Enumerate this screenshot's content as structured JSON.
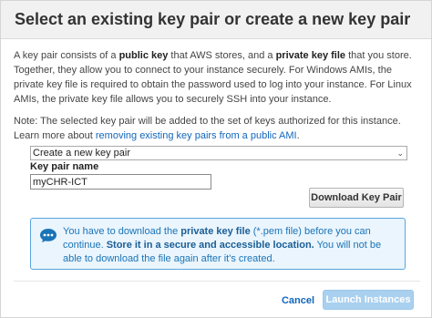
{
  "dialog": {
    "title": "Select an existing key pair or create a new key pair"
  },
  "intro": {
    "t1": "A key pair consists of a ",
    "b1": "public key",
    "t2": " that AWS stores, and a ",
    "b2": "private key file",
    "t3": " that you store. Together, they allow you to connect to your instance securely. For Windows AMIs, the private key file is required to obtain the password used to log into your instance. For Linux AMIs, the private key file allows you to securely SSH into your instance."
  },
  "note": {
    "text": "Note: The selected key pair will be added to the set of keys authorized for this instance. Learn more about ",
    "link": "removing existing key pairs from a public AMI",
    "end": "."
  },
  "key_pair_select": {
    "value": "Create a new key pair",
    "chevron": "⌄"
  },
  "key_pair_name": {
    "label": "Key pair name",
    "value": "myCHR-ICT"
  },
  "download_button": {
    "label": "Download Key Pair"
  },
  "info": {
    "icon": "chat-bubble-icon",
    "t1": "You have to download the ",
    "b1": "private key file",
    "t2": " (*.pem file) before you can continue. ",
    "b2": "Store it in a secure and accessible location.",
    "t3": " You will not be able to download the file again after it's created."
  },
  "footer": {
    "cancel_label": "Cancel",
    "launch_label": "Launch Instances"
  },
  "colors": {
    "accent": "#1166bb",
    "info_border": "#5aa6dc",
    "info_bg": "#eaf5fd",
    "launch_disabled": "#a9d0ef"
  }
}
